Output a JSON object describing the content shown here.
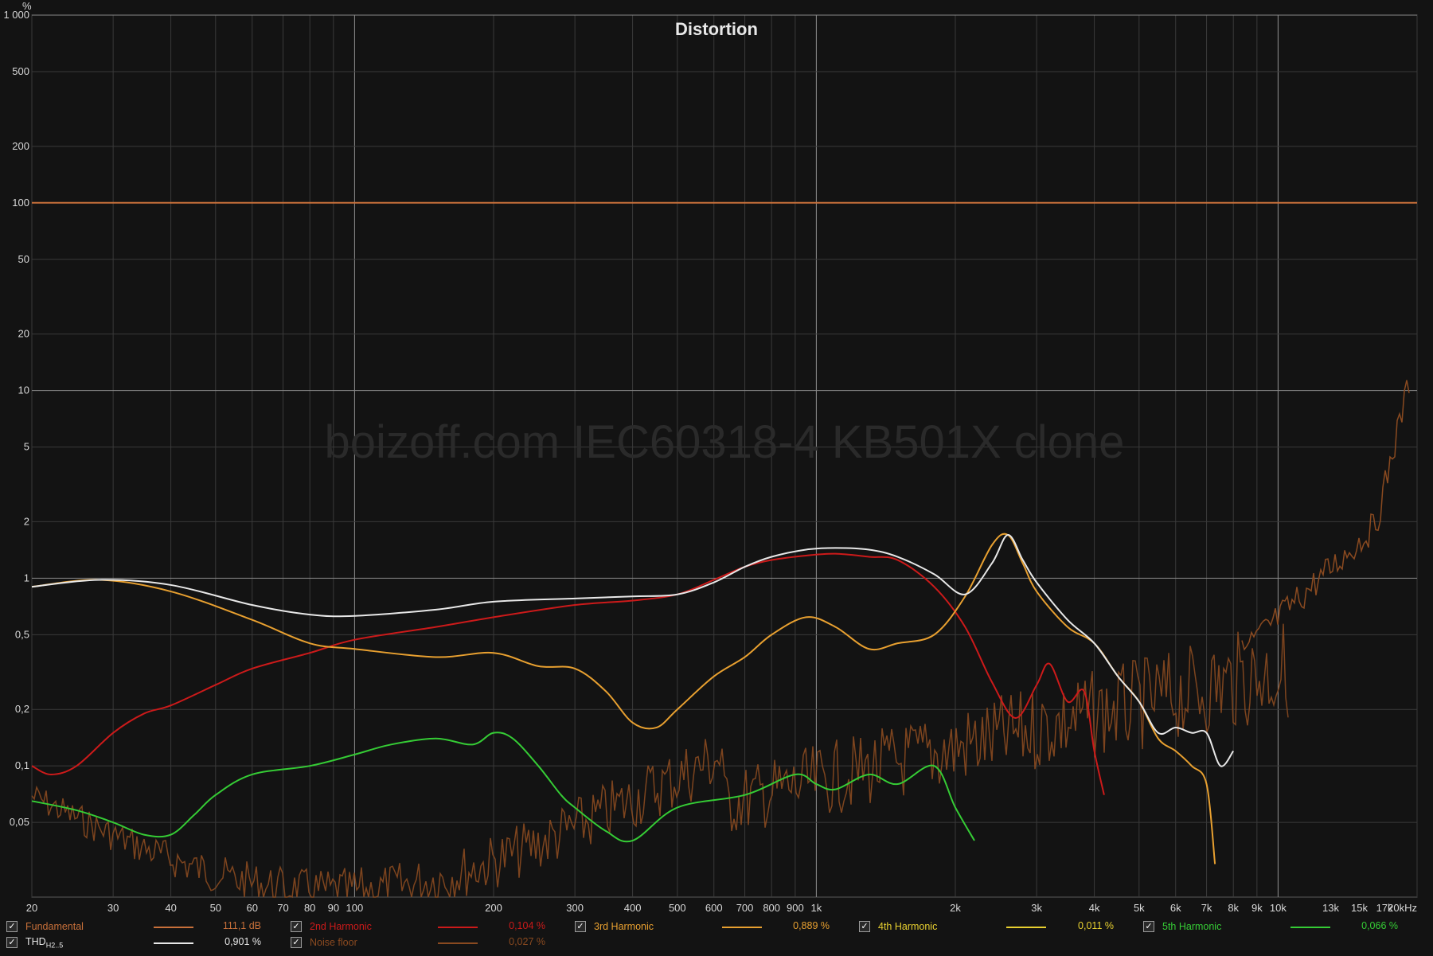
{
  "chart_data": {
    "type": "line",
    "title": "Distortion",
    "watermark": "boizoff.com IEC60318-4 KB501X clone",
    "y_unit": "%",
    "x_unit": "kHz",
    "x_scale": "log",
    "y_scale": "log",
    "xlim": [
      20,
      20000
    ],
    "ylim": [
      0.02,
      1000
    ],
    "x_ticks": [
      {
        "v": 20,
        "label": "20"
      },
      {
        "v": 30,
        "label": "30"
      },
      {
        "v": 40,
        "label": "40"
      },
      {
        "v": 50,
        "label": "50"
      },
      {
        "v": 60,
        "label": "60"
      },
      {
        "v": 70,
        "label": "70"
      },
      {
        "v": 80,
        "label": "80"
      },
      {
        "v": 90,
        "label": "90"
      },
      {
        "v": 100,
        "label": "100"
      },
      {
        "v": 200,
        "label": "200"
      },
      {
        "v": 300,
        "label": "300"
      },
      {
        "v": 400,
        "label": "400"
      },
      {
        "v": 500,
        "label": "500"
      },
      {
        "v": 600,
        "label": "600"
      },
      {
        "v": 700,
        "label": "700"
      },
      {
        "v": 800,
        "label": "800"
      },
      {
        "v": 900,
        "label": "900"
      },
      {
        "v": 1000,
        "label": "1k"
      },
      {
        "v": 2000,
        "label": "2k"
      },
      {
        "v": 3000,
        "label": "3k"
      },
      {
        "v": 4000,
        "label": "4k"
      },
      {
        "v": 5000,
        "label": "5k"
      },
      {
        "v": 6000,
        "label": "6k"
      },
      {
        "v": 7000,
        "label": "7k"
      },
      {
        "v": 8000,
        "label": "8k"
      },
      {
        "v": 9000,
        "label": "9k"
      },
      {
        "v": 10000,
        "label": "10k"
      },
      {
        "v": 13000,
        "label": "13k"
      },
      {
        "v": 15000,
        "label": "15k"
      },
      {
        "v": 17000,
        "label": "17k"
      },
      {
        "v": 20000,
        "label": "20kHz"
      }
    ],
    "y_ticks": [
      {
        "v": 1000,
        "label": "1 000"
      },
      {
        "v": 500,
        "label": "500"
      },
      {
        "v": 200,
        "label": "200"
      },
      {
        "v": 100,
        "label": "100"
      },
      {
        "v": 50,
        "label": "50"
      },
      {
        "v": 20,
        "label": "20"
      },
      {
        "v": 10,
        "label": "10"
      },
      {
        "v": 5,
        "label": "5"
      },
      {
        "v": 2,
        "label": "2"
      },
      {
        "v": 1,
        "label": "1"
      },
      {
        "v": 0.5,
        "label": "0,5"
      },
      {
        "v": 0.2,
        "label": "0,2"
      },
      {
        "v": 0.1,
        "label": "0,1"
      },
      {
        "v": 0.05,
        "label": "0,05"
      }
    ],
    "series": [
      {
        "name": "Fundamental",
        "color": "#c8703a",
        "x": [
          20,
          20000
        ],
        "y": [
          100,
          100
        ]
      },
      {
        "name": "3rd Harmonic",
        "color": "#e8a030",
        "x": [
          20,
          28,
          40,
          60,
          80,
          100,
          150,
          200,
          250,
          300,
          350,
          400,
          450,
          500,
          600,
          700,
          800,
          950,
          1100,
          1300,
          1500,
          1800,
          2100,
          2400,
          2600,
          2800,
          3000,
          3500,
          4000,
          4500,
          5000,
          5500,
          6000,
          6500,
          7000,
          7300
        ],
        "y": [
          0.9,
          0.98,
          0.85,
          0.6,
          0.45,
          0.42,
          0.38,
          0.4,
          0.34,
          0.33,
          0.25,
          0.17,
          0.16,
          0.2,
          0.3,
          0.38,
          0.5,
          0.62,
          0.55,
          0.42,
          0.45,
          0.5,
          0.8,
          1.5,
          1.7,
          1.2,
          0.85,
          0.55,
          0.45,
          0.3,
          0.22,
          0.14,
          0.12,
          0.1,
          0.08,
          0.03
        ]
      },
      {
        "name": "THD",
        "color": "#e8e8e8",
        "x": [
          20,
          28,
          40,
          60,
          80,
          100,
          150,
          200,
          300,
          400,
          500,
          600,
          700,
          800,
          950,
          1100,
          1300,
          1500,
          1800,
          2100,
          2400,
          2600,
          2800,
          3000,
          3500,
          4000,
          4500,
          5000,
          5500,
          6000,
          6500,
          7000,
          7500,
          8000
        ],
        "y": [
          0.9,
          0.98,
          0.92,
          0.72,
          0.64,
          0.63,
          0.68,
          0.75,
          0.78,
          0.8,
          0.82,
          0.95,
          1.15,
          1.3,
          1.42,
          1.45,
          1.42,
          1.3,
          1.05,
          0.82,
          1.2,
          1.7,
          1.25,
          0.95,
          0.6,
          0.45,
          0.3,
          0.22,
          0.15,
          0.16,
          0.15,
          0.15,
          0.1,
          0.12
        ]
      },
      {
        "name": "2nd Harmonic",
        "color": "#cc1a1a",
        "x": [
          20,
          22,
          25,
          30,
          35,
          40,
          50,
          60,
          80,
          100,
          150,
          200,
          300,
          400,
          500,
          600,
          700,
          800,
          950,
          1100,
          1300,
          1500,
          1800,
          2100,
          2400,
          2700,
          3000,
          3200,
          3500,
          3800,
          4000,
          4200
        ],
        "y": [
          0.1,
          0.09,
          0.1,
          0.15,
          0.19,
          0.21,
          0.27,
          0.33,
          0.4,
          0.47,
          0.55,
          0.62,
          0.72,
          0.76,
          0.82,
          0.98,
          1.15,
          1.25,
          1.32,
          1.35,
          1.3,
          1.25,
          0.9,
          0.55,
          0.28,
          0.18,
          0.27,
          0.35,
          0.22,
          0.25,
          0.12,
          0.07
        ]
      },
      {
        "name": "5th Harmonic",
        "color": "#35cc35",
        "x": [
          20,
          25,
          30,
          35,
          40,
          45,
          50,
          60,
          80,
          100,
          120,
          150,
          180,
          200,
          220,
          250,
          280,
          300,
          350,
          400,
          500,
          700,
          900,
          1000,
          1100,
          1300,
          1500,
          1800,
          2000,
          2200
        ],
        "y": [
          0.065,
          0.058,
          0.05,
          0.043,
          0.043,
          0.055,
          0.07,
          0.09,
          0.1,
          0.115,
          0.13,
          0.14,
          0.13,
          0.15,
          0.14,
          0.1,
          0.07,
          0.06,
          0.045,
          0.04,
          0.06,
          0.07,
          0.09,
          0.08,
          0.075,
          0.09,
          0.08,
          0.1,
          0.06,
          0.04
        ]
      }
    ]
  },
  "legend": {
    "fundamental": {
      "label": "Fundamental",
      "value": "111,1 dB",
      "color": "#c8703a"
    },
    "second": {
      "label": "2nd Harmonic",
      "value": "0,104 %",
      "color": "#cc1a1a"
    },
    "third": {
      "label": "3rd Harmonic",
      "value": "0,889 %",
      "color": "#e8a030"
    },
    "fourth": {
      "label": "4th Harmonic",
      "value": "0,011 %",
      "color": "#e8d030"
    },
    "fifth": {
      "label": "5th Harmonic",
      "value": "0,066 %",
      "color": "#35cc35"
    },
    "thd": {
      "label": "THD",
      "label_sub": "H2..5",
      "value": "0,901 %",
      "color": "#e8e8e8"
    },
    "noise": {
      "label": "Noise floor",
      "value": "0,027 %",
      "color": "#8a4a20"
    }
  }
}
